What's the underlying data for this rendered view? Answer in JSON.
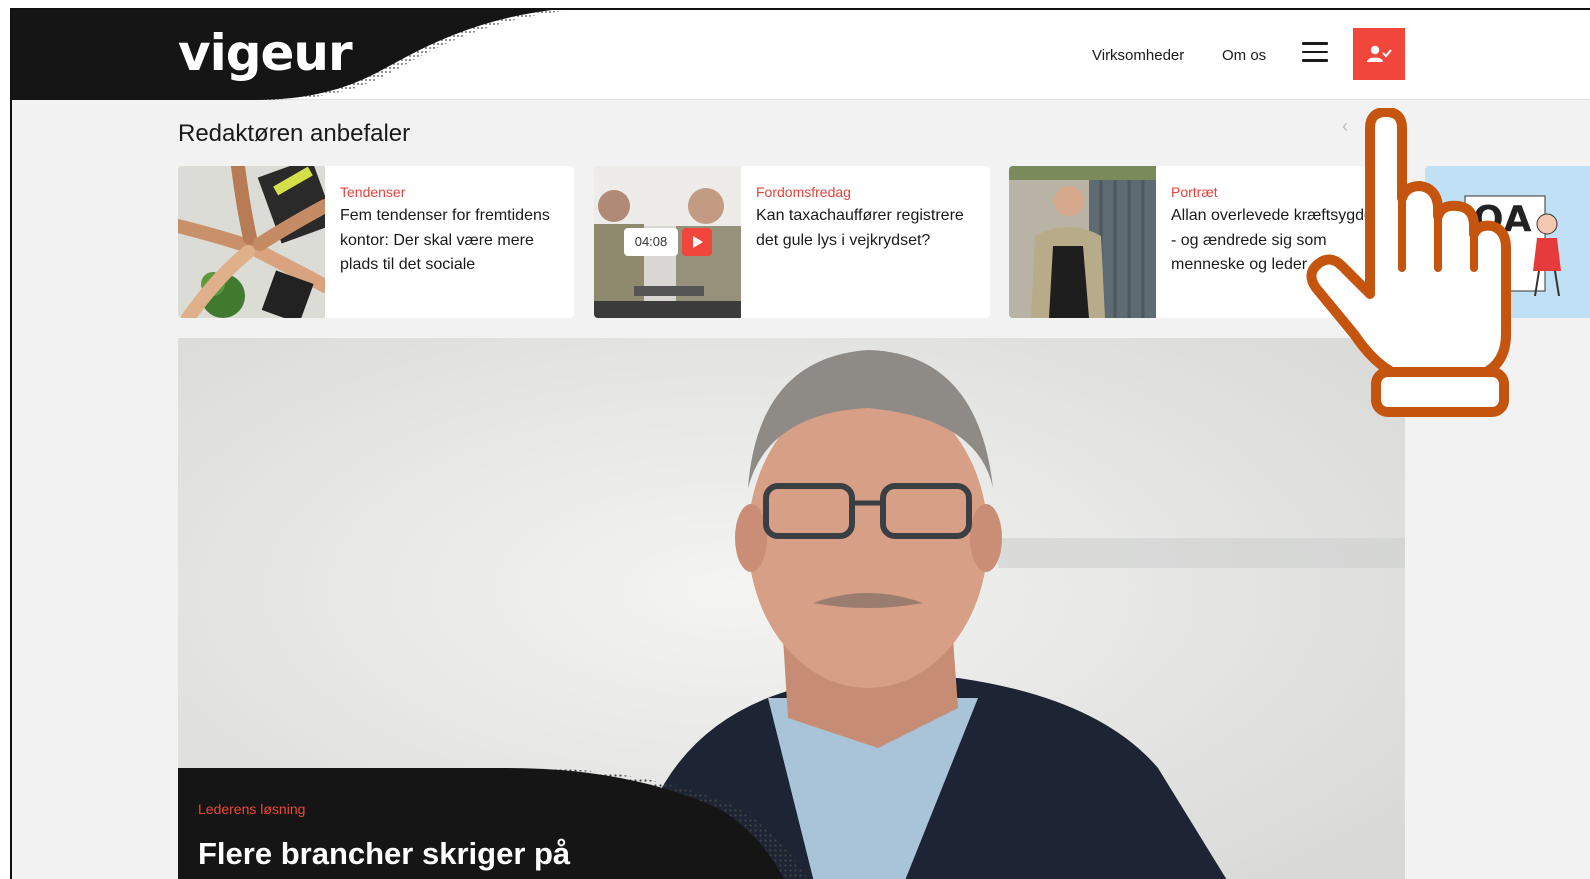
{
  "header": {
    "logo": "vigeur",
    "nav": {
      "virksomheder": "Virksomheder",
      "om_os": "Om os"
    },
    "menu_icon": "hamburger-menu-icon",
    "user_icon": "user-check-icon",
    "accent_color": "#f0463c"
  },
  "section": {
    "title": "Redaktøren anbefaler",
    "cards": [
      {
        "category": "Tendenser",
        "title": "Fem tendenser for fremtidens kontor: Der skal være mere plads til det sociale"
      },
      {
        "category": "Fordomsfredag",
        "title": "Kan taxachauffører registrere det gule lys i vejkrydset?",
        "video_duration": "04:08"
      },
      {
        "category": "Portræt",
        "title": "Allan overlevede kræftsygdom - og ændrede sig som menneske og leder"
      },
      {
        "thumb_text": "QA"
      }
    ]
  },
  "hero": {
    "category": "Lederens løsning",
    "title": "Flere brancher skriger på"
  }
}
